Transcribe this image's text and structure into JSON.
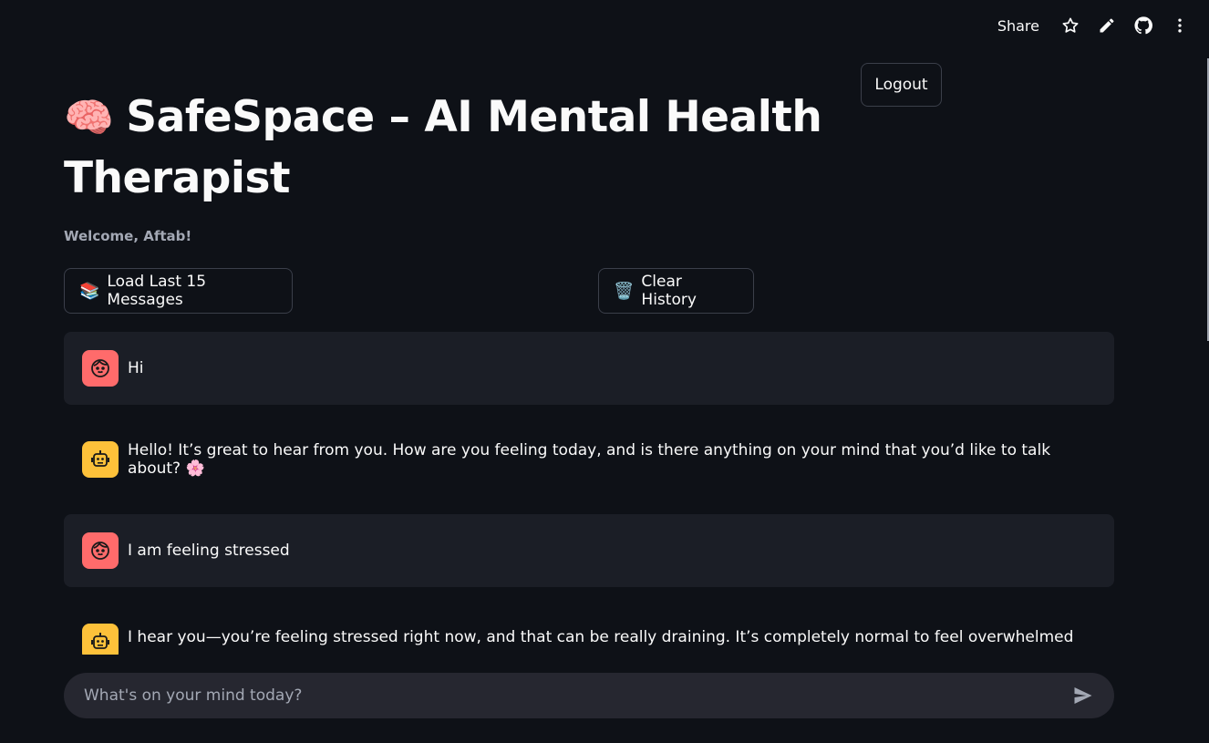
{
  "toolbar": {
    "share_label": "Share",
    "icons": [
      "star-icon",
      "pencil-icon",
      "github-icon",
      "more-vertical-icon"
    ]
  },
  "header": {
    "logout_label": "Logout",
    "title_emoji": "🧠",
    "title": "SafeSpace – AI Mental Health Therapist",
    "welcome": "Welcome, Aftab!"
  },
  "actions": {
    "load_icon": "📚",
    "load_label": "Load Last 15 Messages",
    "clear_icon": "🗑️",
    "clear_label": "Clear History"
  },
  "messages": [
    {
      "role": "user",
      "text": "Hi"
    },
    {
      "role": "assistant",
      "text": "Hello! It’s great to hear from you. How are you feeling today, and is there anything on your mind that you’d like to talk about? 🌸"
    },
    {
      "role": "user",
      "text": "I am feeling stressed"
    },
    {
      "role": "assistant",
      "text": "I hear you—you’re feeling stressed right now, and that can be really draining. It’s completely normal to feel overwhelmed when"
    }
  ],
  "chat_input": {
    "placeholder": "What's on your mind today?"
  },
  "colors": {
    "background": "#0e1117",
    "user_avatar": "#ff6b6b",
    "bot_avatar": "#fdc13a",
    "user_message_bg": "#1b1e26",
    "input_bg": "#262730"
  }
}
